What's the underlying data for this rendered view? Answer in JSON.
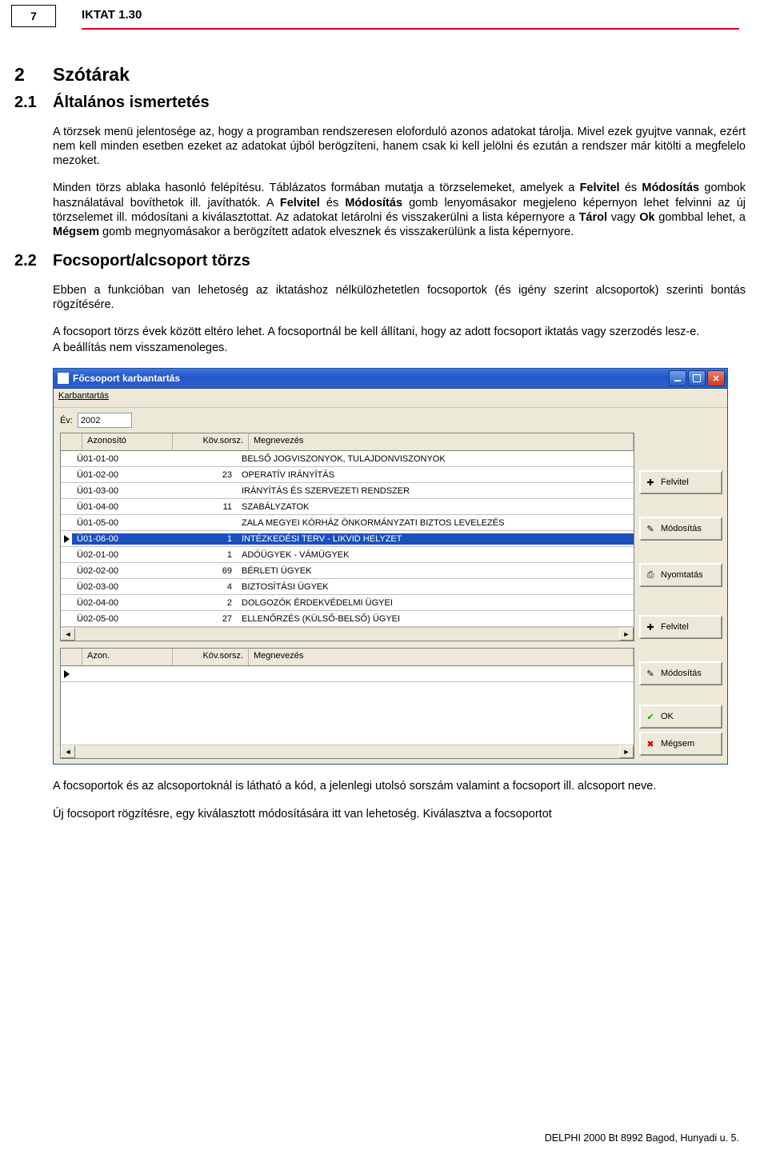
{
  "page_number": "7",
  "doc_title": "IKTAT 1.30",
  "h1_num": "2",
  "h1_txt": "Szótárak",
  "h2a_num": "2.1",
  "h2a_txt": "Általános ismertetés",
  "para1": "A törzsek menü jelentosége az, hogy a programban rendszeresen eloforduló azonos adatokat tárolja. Mivel ezek gyujtve vannak, ezért nem kell minden esetben ezeket az adatokat újból berögzíteni, hanem csak ki kell jelölni és ezután a rendszer már kitölti a megfelelo mezoket.",
  "para2_a": "Minden törzs ablaka hasonló felépítésu. Táblázatos formában mutatja a törzselemeket, amelyek a ",
  "para2_b": "Felvitel",
  "para2_c": " és ",
  "para2_d": "Módosítás",
  "para2_e": " gombok használatával bovíthetok ill. javíthatók. A ",
  "para2_f": "Felvitel",
  "para2_g": " és ",
  "para2_h": "Módosítás",
  "para2_i": " gomb lenyomásakor megjeleno képernyon lehet felvinni az új törzselemet ill. módosítani a kiválasztottat. Az adatokat letárolni és visszakerülni a lista képernyore a ",
  "para2_j": "Tárol",
  "para2_k": " vagy ",
  "para2_l": "Ok",
  "para2_m": " gombbal lehet, a ",
  "para2_n": "Mégsem",
  "para2_o": " gomb megnyomásakor a berögzített adatok elvesznek és visszakerülünk a lista képernyore.",
  "h2b_num": "2.2",
  "h2b_txt": "Focsoport/alcsoport törzs",
  "para3": "Ebben a funkcióban van lehetoség az iktatáshoz nélkülözhetetlen focsoportok (és igény szerint alcsoportok) szerinti bontás rögzítésére.",
  "para4": "A focsoport törzs évek között eltéro lehet. A focsoportnál be kell állítani, hogy az adott focsoport iktatás vagy szerzodés lesz-e.",
  "para5": "A beállítás nem visszamenoleges.",
  "win": {
    "title": "Főcsoport karbantartás",
    "menu": "Karbantartás",
    "ev_label": "Év:",
    "ev_value": "2002",
    "hdr_az": "Azonosító",
    "hdr_ks": "Köv.sorsz.",
    "hdr_mn": "Megnevezés",
    "hdr2_az": "Azon.",
    "rows": [
      {
        "az": "Ü01-01-00",
        "ks": "",
        "mn": "BELSŐ JOGVISZONYOK, TULAJDONVISZONYOK",
        "sel": false
      },
      {
        "az": "Ü01-02-00",
        "ks": "23",
        "mn": "OPERATÍV IRÁNYÍTÁS",
        "sel": false
      },
      {
        "az": "Ü01-03-00",
        "ks": "",
        "mn": "IRÁNYÍTÁS ÉS SZERVEZETI RENDSZER",
        "sel": false
      },
      {
        "az": "Ü01-04-00",
        "ks": "11",
        "mn": "SZABÁLYZATOK",
        "sel": false
      },
      {
        "az": "Ü01-05-00",
        "ks": "",
        "mn": "ZALA MEGYEI KÓRHÁZ ÖNKORMÁNYZATI BIZTOS LEVELEZÉS",
        "sel": false
      },
      {
        "az": "Ü01-06-00",
        "ks": "1",
        "mn": "INTÉZKEDÉSI TERV - LIKVID HELYZET",
        "sel": true
      },
      {
        "az": "Ü02-01-00",
        "ks": "1",
        "mn": "ADÓÜGYEK - VÁMÜGYEK",
        "sel": false
      },
      {
        "az": "Ü02-02-00",
        "ks": "69",
        "mn": "BÉRLETI ÜGYEK",
        "sel": false
      },
      {
        "az": "Ü02-03-00",
        "ks": "4",
        "mn": "BIZTOSÍTÁSI ÜGYEK",
        "sel": false
      },
      {
        "az": "Ü02-04-00",
        "ks": "2",
        "mn": "DOLGOZÓK ÉRDEKVÉDELMI ÜGYEI",
        "sel": false
      },
      {
        "az": "Ü02-05-00",
        "ks": "27",
        "mn": "ELLENŐRZÉS (KÜLSŐ-BELSŐ) ÜGYEI",
        "sel": false
      }
    ],
    "btn_felvitel": "Felvitel",
    "btn_modositas": "Módosítás",
    "btn_nyomtatas": "Nyomtatás",
    "btn_ok": "OK",
    "btn_megsem": "Mégsem"
  },
  "para6": "A focsoportok és az alcsoportoknál is látható a kód, a jelenlegi utolsó sorszám valamint a focsoport ill. alcsoport neve.",
  "para7": "Új focsoport rögzítésre, egy kiválasztott módosítására itt van lehetoség. Kiválasztva a focsoportot",
  "footer": "DELPHI 2000 Bt 8992 Bagod, Hunyadi u. 5."
}
